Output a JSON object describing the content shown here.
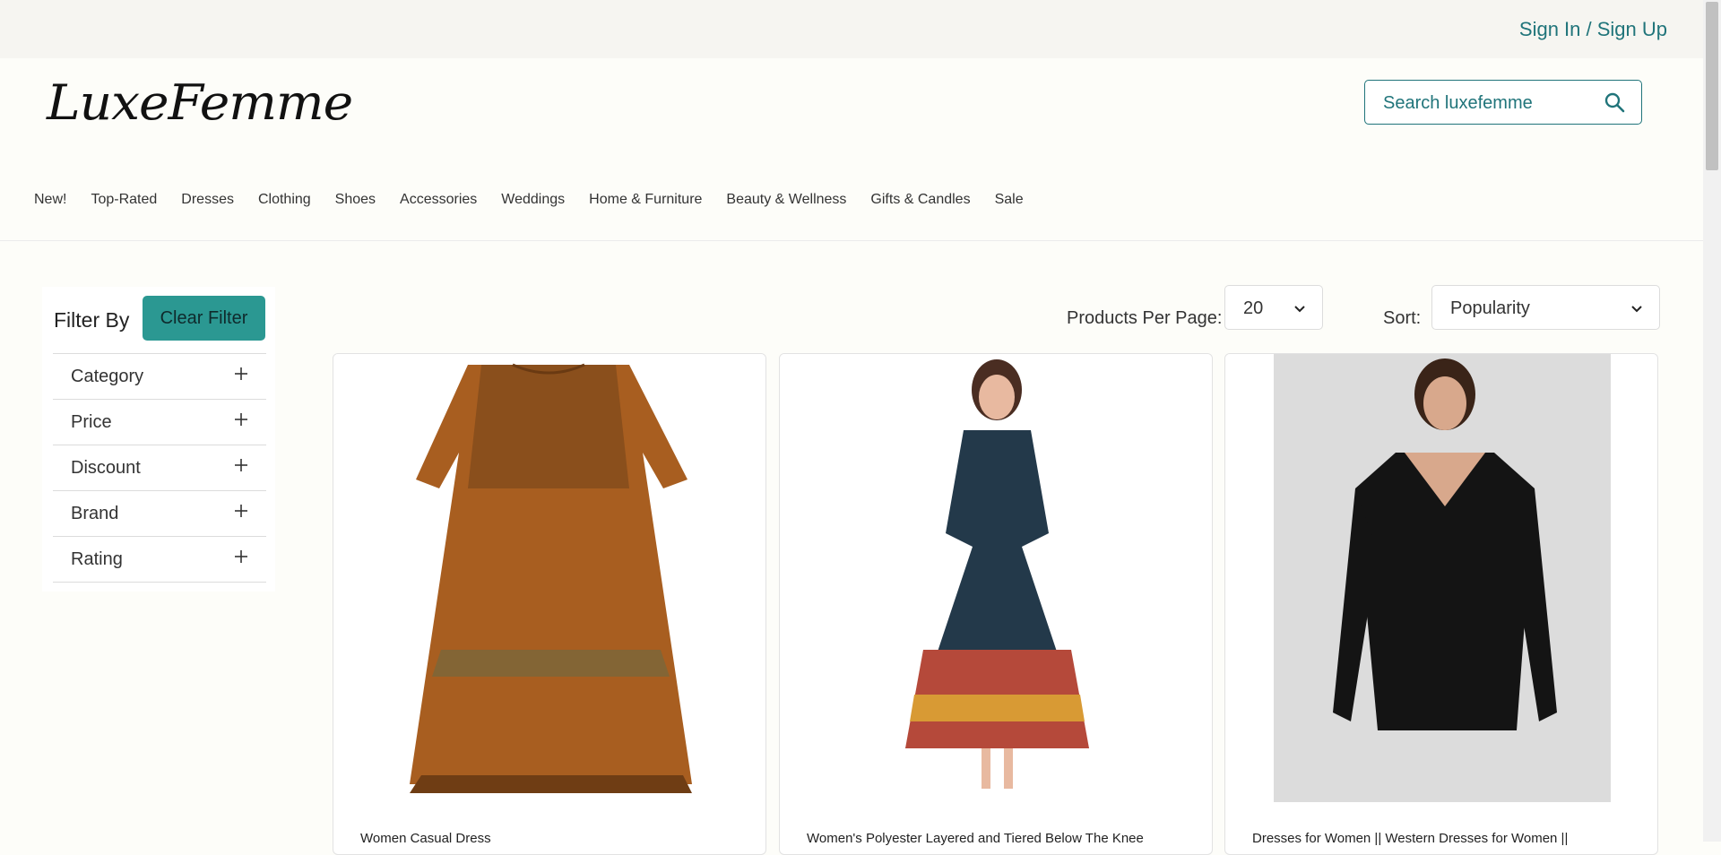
{
  "topbar": {
    "signin_label": "Sign In / Sign Up"
  },
  "header": {
    "logo_text": "LuxeFemme",
    "search_placeholder": "Search luxefemme"
  },
  "nav": {
    "items": [
      "New!",
      "Top-Rated",
      "Dresses",
      "Clothing",
      "Shoes",
      "Accessories",
      "Weddings",
      "Home & Furniture",
      "Beauty & Wellness",
      "Gifts & Candles",
      "Sale"
    ]
  },
  "sidebar": {
    "title": "Filter By",
    "clear_label": "Clear Filter",
    "filters": [
      "Category",
      "Price",
      "Discount",
      "Brand",
      "Rating"
    ]
  },
  "controls": {
    "per_page_label": "Products Per Page:",
    "per_page_value": "20",
    "sort_label": "Sort:",
    "sort_value": "Popularity"
  },
  "products": [
    {
      "title": "Women Casual Dress"
    },
    {
      "title": "Women's Polyester Layered and Tiered Below The Knee"
    },
    {
      "title": "Dresses for Women || Western Dresses for Women ||"
    }
  ],
  "colors": {
    "accent": "#20747a",
    "button_bg": "#2b9892",
    "page_bg": "#fdfdf9",
    "topbar_bg": "#f6f5f1"
  }
}
